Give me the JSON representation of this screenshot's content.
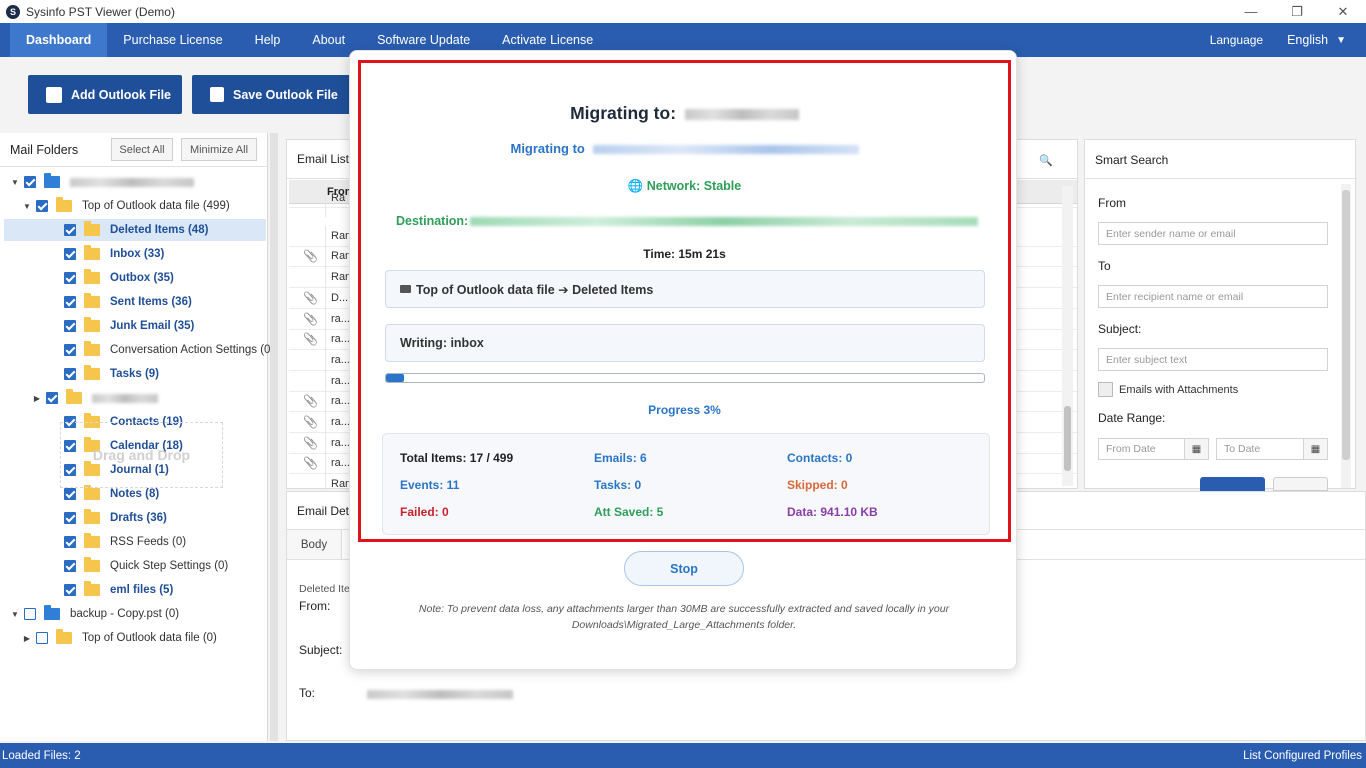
{
  "app": {
    "title": "Sysinfo PST Viewer (Demo)",
    "logo_letter": "S"
  },
  "window_controls": {
    "minimize": "—",
    "restore": "❐",
    "close": "✕"
  },
  "menu": {
    "items": [
      "Dashboard",
      "Purchase License",
      "Help",
      "About",
      "Software Update",
      "Activate License"
    ],
    "language_label": "Language",
    "language_value": "English"
  },
  "toolbar": {
    "add_label": "Add Outlook File",
    "save_label": "Save Outlook File"
  },
  "mail_folders": {
    "title": "Mail Folders",
    "select_all": "Select All",
    "minimize_all": "Minimize All",
    "drag_drop": "Drag and Drop",
    "tree": [
      {
        "label": "",
        "checked": true,
        "blue": true,
        "blur": true,
        "expander": "▼"
      },
      {
        "label": "Top of Outlook data file (499)",
        "checked": true,
        "expander": "▼"
      },
      {
        "label": "Deleted Items (48)",
        "checked": true,
        "bold": true,
        "selected": true
      },
      {
        "label": "Inbox (33)",
        "checked": true,
        "bold": true
      },
      {
        "label": "Outbox (35)",
        "checked": true,
        "bold": true
      },
      {
        "label": "Sent Items (36)",
        "checked": true,
        "bold": true
      },
      {
        "label": "Junk Email (35)",
        "checked": true,
        "bold": true
      },
      {
        "label": "Conversation Action Settings (0)",
        "checked": true
      },
      {
        "label": "Tasks (9)",
        "checked": true,
        "bold": true
      },
      {
        "label": "",
        "checked": true,
        "blur": true,
        "expander": "▶"
      },
      {
        "label": "Contacts (19)",
        "checked": true,
        "bold": true
      },
      {
        "label": "Calendar (18)",
        "checked": true,
        "bold": true
      },
      {
        "label": "Journal (1)",
        "checked": true,
        "bold": true
      },
      {
        "label": "Notes (8)",
        "checked": true,
        "bold": true
      },
      {
        "label": "Drafts (36)",
        "checked": true,
        "bold": true
      },
      {
        "label": "RSS Feeds (0)",
        "checked": true
      },
      {
        "label": "Quick Step Settings (0)",
        "checked": true
      },
      {
        "label": "eml files (5)",
        "checked": true,
        "bold": true
      },
      {
        "label": "backup - Copy.pst (0)",
        "checked": false,
        "blue": true,
        "expander": "▼"
      },
      {
        "label": "Top of Outlook data file (0)",
        "checked": false,
        "expander": "▶"
      }
    ]
  },
  "email_list": {
    "title": "Email List",
    "search_icon": "🔍",
    "col_from": "From",
    "rows": [
      {
        "attach": false,
        "from": "Ra"
      },
      {
        "attach": false,
        "from": "Ran"
      },
      {
        "attach": true,
        "from": "Ran"
      },
      {
        "attach": false,
        "from": "Ran"
      },
      {
        "attach": true,
        "from": "D..."
      },
      {
        "attach": true,
        "from": "ra..."
      },
      {
        "attach": true,
        "from": "ra..."
      },
      {
        "attach": false,
        "from": "ra..."
      },
      {
        "attach": false,
        "from": "ra..."
      },
      {
        "attach": true,
        "from": "ra..."
      },
      {
        "attach": true,
        "from": "ra..."
      },
      {
        "attach": true,
        "from": "ra..."
      },
      {
        "attach": true,
        "from": "ra..."
      },
      {
        "attach": false,
        "from": "Ran"
      }
    ]
  },
  "email_details": {
    "title": "Email Details",
    "tab_body": "Body",
    "deleted_label": "Deleted Ite",
    "from_label": "From:",
    "subject_label": "Subject:",
    "to_label": "To:"
  },
  "smart_search": {
    "title": "Smart Search",
    "from_label": "From",
    "from_placeholder": "Enter sender name or email",
    "to_label": "To",
    "to_placeholder": "Enter recipient name or email",
    "subject_label": "Subject:",
    "subject_placeholder": "Enter subject text",
    "attach_label": "Emails with Attachments",
    "date_label": "Date Range:",
    "from_date": "From Date",
    "to_date": "To Date",
    "calendar_icon": "▦"
  },
  "status": {
    "loaded": "Loaded Files: 2",
    "profiles": "List Configured Profiles"
  },
  "migration": {
    "title": "Migrating to:",
    "subtitle": "Migrating to",
    "network": "🌐 Network: Stable",
    "destination": "Destination:",
    "time": "Time: 15m 21s",
    "path": "Top of Outlook data file ➔ Deleted Items",
    "writing": "Writing: inbox",
    "progress_pct": 3,
    "progress_label": "Progress 3%",
    "stats": {
      "total": "Total Items: 17 / 499",
      "emails": "Emails: 6",
      "contacts": "Contacts: 0",
      "events": "Events: 11",
      "tasks": "Tasks: 0",
      "skipped": "Skipped: 0",
      "failed": "Failed: 0",
      "att_saved": "Att Saved: 5",
      "data": "Data: 941.10 KB"
    },
    "stop_label": "Stop",
    "note": "Note: To prevent data loss, any attachments larger than 30MB are successfully extracted and saved locally in your Downloads\\Migrated_Large_Attachments folder."
  },
  "colors": {
    "brand_blue": "#2a5db0",
    "accent_red": "#e0121c",
    "green": "#2f9e58",
    "link_blue": "#2a75c7",
    "skipped_orange": "#d9683a",
    "failed_red": "#c8202a",
    "data_purple": "#8a3ea8"
  }
}
